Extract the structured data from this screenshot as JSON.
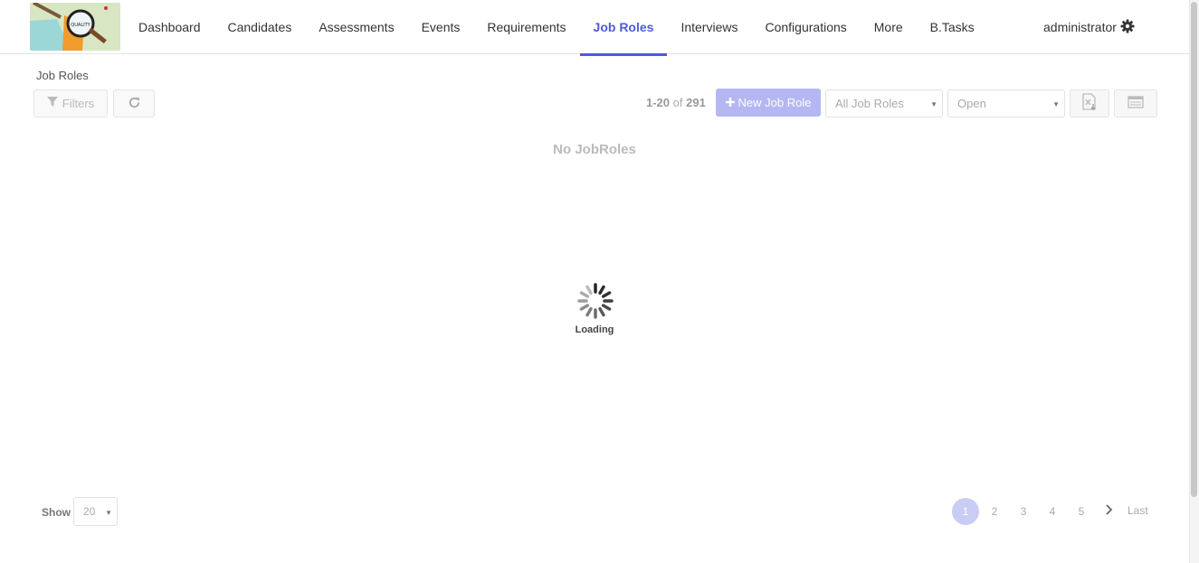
{
  "header": {
    "nav": [
      {
        "label": "Dashboard"
      },
      {
        "label": "Candidates"
      },
      {
        "label": "Assessments"
      },
      {
        "label": "Events"
      },
      {
        "label": "Requirements"
      },
      {
        "label": "Job Roles",
        "active": true
      },
      {
        "label": "Interviews"
      },
      {
        "label": "Configurations"
      },
      {
        "label": "More"
      },
      {
        "label": "B.Tasks"
      }
    ],
    "user": "administrator",
    "logo_text": "QUALITY"
  },
  "breadcrumb": "Job Roles",
  "toolbar": {
    "filters_label": "Filters",
    "range": "1-20",
    "of": "of",
    "total": "291",
    "new_label": "New Job Role",
    "scope_select": "All Job Roles",
    "status_select": "Open"
  },
  "empty_message": "No JobRoles",
  "loading_label": "Loading",
  "footer": {
    "show_label": "Show",
    "page_size": "20",
    "pages": [
      "1",
      "2",
      "3",
      "4",
      "5"
    ],
    "current_page": "1",
    "last_label": "Last"
  },
  "colors": {
    "accent": "#4f5bd5",
    "primary_button": "#b4b7f2",
    "active_page": "#c9cdf6"
  }
}
